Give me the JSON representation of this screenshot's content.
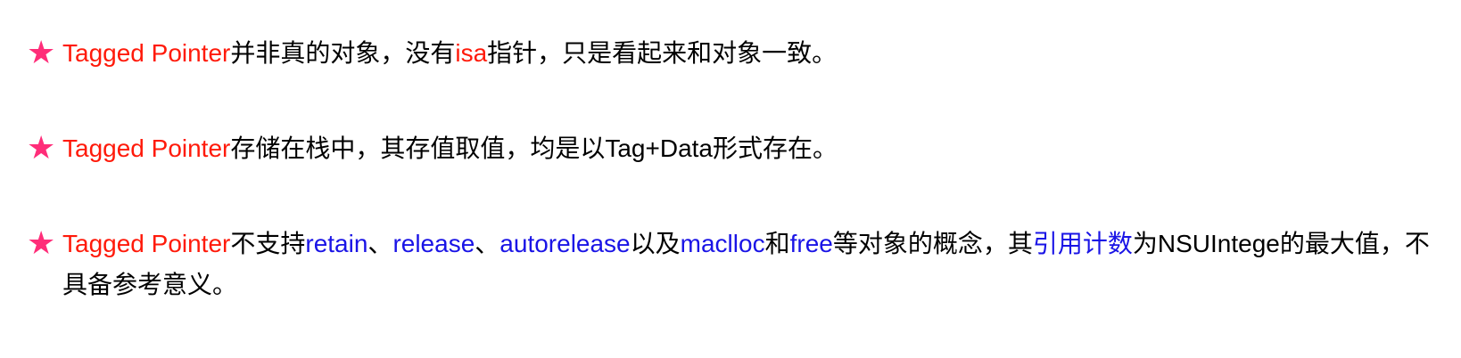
{
  "colors": {
    "star": "#ff2d79",
    "highlight_red": "#ff1a0a",
    "highlight_blue": "#1a14e6",
    "text": "#000000"
  },
  "icons": {
    "bullet": "star-icon",
    "glyph": "★"
  },
  "items": [
    {
      "segments": [
        {
          "text": "Tagged Pointer",
          "style": "red"
        },
        {
          "text": "并非真的对象，没有",
          "style": "plain"
        },
        {
          "text": "isa",
          "style": "red"
        },
        {
          "text": "指针，只是看起来和对象一致。",
          "style": "plain"
        }
      ]
    },
    {
      "segments": [
        {
          "text": "Tagged Pointer",
          "style": "red"
        },
        {
          "text": "存储在栈中，其存值取值，均是以Tag+Data形式存在。",
          "style": "plain"
        }
      ]
    },
    {
      "segments": [
        {
          "text": "Tagged Pointer",
          "style": "red"
        },
        {
          "text": "不支持",
          "style": "plain"
        },
        {
          "text": "retain",
          "style": "blue"
        },
        {
          "text": "、",
          "style": "plain"
        },
        {
          "text": "release",
          "style": "blue"
        },
        {
          "text": "、",
          "style": "plain"
        },
        {
          "text": "autorelease",
          "style": "blue"
        },
        {
          "text": "以及",
          "style": "plain"
        },
        {
          "text": "maclloc",
          "style": "blue"
        },
        {
          "text": "和",
          "style": "plain"
        },
        {
          "text": "free",
          "style": "blue"
        },
        {
          "text": "等对象的概念，其",
          "style": "plain"
        },
        {
          "text": "引用计数",
          "style": "blue"
        },
        {
          "text": "为NSUIntege的最大值，不具备参考意义。",
          "style": "plain"
        }
      ]
    }
  ]
}
